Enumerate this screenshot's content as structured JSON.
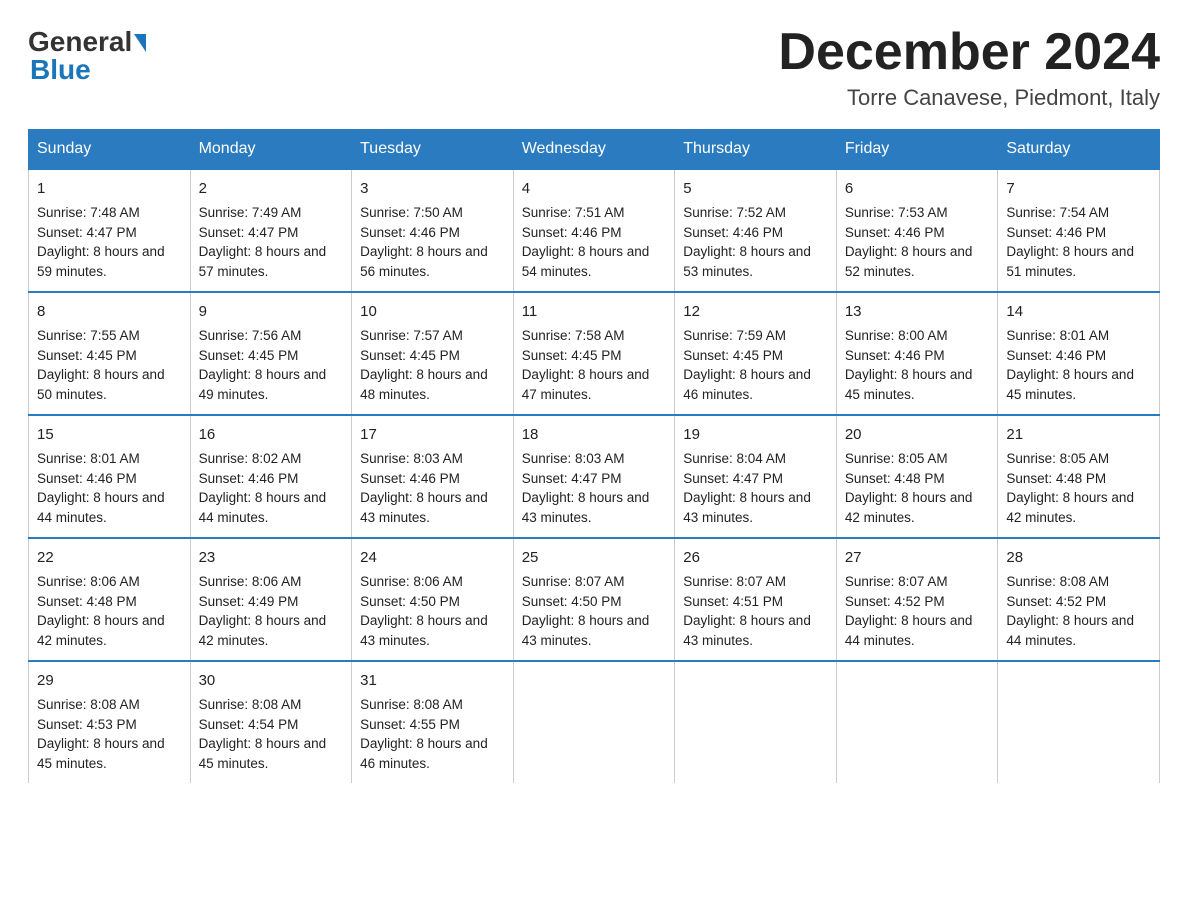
{
  "header": {
    "logo_general": "General",
    "logo_blue": "Blue",
    "month_title": "December 2024",
    "location": "Torre Canavese, Piedmont, Italy"
  },
  "days_of_week": [
    "Sunday",
    "Monday",
    "Tuesday",
    "Wednesday",
    "Thursday",
    "Friday",
    "Saturday"
  ],
  "weeks": [
    [
      {
        "day": "1",
        "sunrise": "7:48 AM",
        "sunset": "4:47 PM",
        "daylight": "8 hours and 59 minutes."
      },
      {
        "day": "2",
        "sunrise": "7:49 AM",
        "sunset": "4:47 PM",
        "daylight": "8 hours and 57 minutes."
      },
      {
        "day": "3",
        "sunrise": "7:50 AM",
        "sunset": "4:46 PM",
        "daylight": "8 hours and 56 minutes."
      },
      {
        "day": "4",
        "sunrise": "7:51 AM",
        "sunset": "4:46 PM",
        "daylight": "8 hours and 54 minutes."
      },
      {
        "day": "5",
        "sunrise": "7:52 AM",
        "sunset": "4:46 PM",
        "daylight": "8 hours and 53 minutes."
      },
      {
        "day": "6",
        "sunrise": "7:53 AM",
        "sunset": "4:46 PM",
        "daylight": "8 hours and 52 minutes."
      },
      {
        "day": "7",
        "sunrise": "7:54 AM",
        "sunset": "4:46 PM",
        "daylight": "8 hours and 51 minutes."
      }
    ],
    [
      {
        "day": "8",
        "sunrise": "7:55 AM",
        "sunset": "4:45 PM",
        "daylight": "8 hours and 50 minutes."
      },
      {
        "day": "9",
        "sunrise": "7:56 AM",
        "sunset": "4:45 PM",
        "daylight": "8 hours and 49 minutes."
      },
      {
        "day": "10",
        "sunrise": "7:57 AM",
        "sunset": "4:45 PM",
        "daylight": "8 hours and 48 minutes."
      },
      {
        "day": "11",
        "sunrise": "7:58 AM",
        "sunset": "4:45 PM",
        "daylight": "8 hours and 47 minutes."
      },
      {
        "day": "12",
        "sunrise": "7:59 AM",
        "sunset": "4:45 PM",
        "daylight": "8 hours and 46 minutes."
      },
      {
        "day": "13",
        "sunrise": "8:00 AM",
        "sunset": "4:46 PM",
        "daylight": "8 hours and 45 minutes."
      },
      {
        "day": "14",
        "sunrise": "8:01 AM",
        "sunset": "4:46 PM",
        "daylight": "8 hours and 45 minutes."
      }
    ],
    [
      {
        "day": "15",
        "sunrise": "8:01 AM",
        "sunset": "4:46 PM",
        "daylight": "8 hours and 44 minutes."
      },
      {
        "day": "16",
        "sunrise": "8:02 AM",
        "sunset": "4:46 PM",
        "daylight": "8 hours and 44 minutes."
      },
      {
        "day": "17",
        "sunrise": "8:03 AM",
        "sunset": "4:46 PM",
        "daylight": "8 hours and 43 minutes."
      },
      {
        "day": "18",
        "sunrise": "8:03 AM",
        "sunset": "4:47 PM",
        "daylight": "8 hours and 43 minutes."
      },
      {
        "day": "19",
        "sunrise": "8:04 AM",
        "sunset": "4:47 PM",
        "daylight": "8 hours and 43 minutes."
      },
      {
        "day": "20",
        "sunrise": "8:05 AM",
        "sunset": "4:48 PM",
        "daylight": "8 hours and 42 minutes."
      },
      {
        "day": "21",
        "sunrise": "8:05 AM",
        "sunset": "4:48 PM",
        "daylight": "8 hours and 42 minutes."
      }
    ],
    [
      {
        "day": "22",
        "sunrise": "8:06 AM",
        "sunset": "4:48 PM",
        "daylight": "8 hours and 42 minutes."
      },
      {
        "day": "23",
        "sunrise": "8:06 AM",
        "sunset": "4:49 PM",
        "daylight": "8 hours and 42 minutes."
      },
      {
        "day": "24",
        "sunrise": "8:06 AM",
        "sunset": "4:50 PM",
        "daylight": "8 hours and 43 minutes."
      },
      {
        "day": "25",
        "sunrise": "8:07 AM",
        "sunset": "4:50 PM",
        "daylight": "8 hours and 43 minutes."
      },
      {
        "day": "26",
        "sunrise": "8:07 AM",
        "sunset": "4:51 PM",
        "daylight": "8 hours and 43 minutes."
      },
      {
        "day": "27",
        "sunrise": "8:07 AM",
        "sunset": "4:52 PM",
        "daylight": "8 hours and 44 minutes."
      },
      {
        "day": "28",
        "sunrise": "8:08 AM",
        "sunset": "4:52 PM",
        "daylight": "8 hours and 44 minutes."
      }
    ],
    [
      {
        "day": "29",
        "sunrise": "8:08 AM",
        "sunset": "4:53 PM",
        "daylight": "8 hours and 45 minutes."
      },
      {
        "day": "30",
        "sunrise": "8:08 AM",
        "sunset": "4:54 PM",
        "daylight": "8 hours and 45 minutes."
      },
      {
        "day": "31",
        "sunrise": "8:08 AM",
        "sunset": "4:55 PM",
        "daylight": "8 hours and 46 minutes."
      },
      null,
      null,
      null,
      null
    ]
  ],
  "labels": {
    "sunrise_prefix": "Sunrise: ",
    "sunset_prefix": "Sunset: ",
    "daylight_prefix": "Daylight: "
  }
}
